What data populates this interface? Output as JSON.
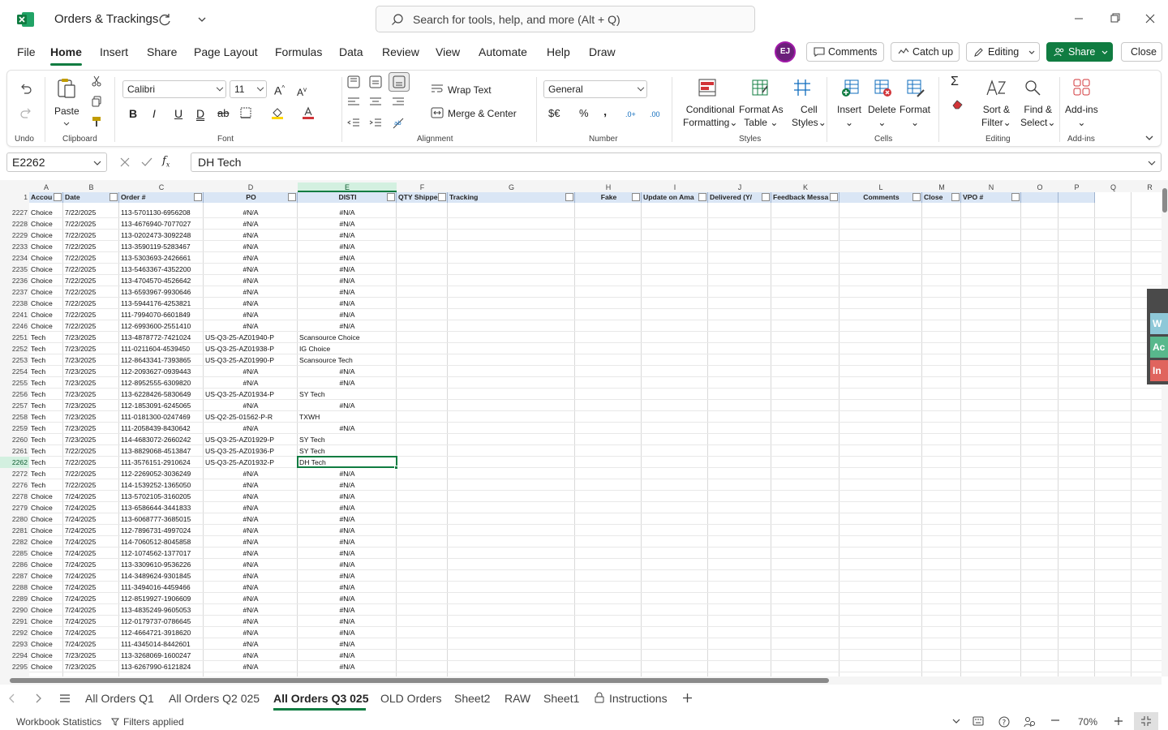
{
  "titlebar": {
    "doc_title": "Orders & Trackings",
    "search_placeholder": "Search for tools, help, and more (Alt + Q)"
  },
  "menu": [
    "File",
    "Home",
    "Insert",
    "Share",
    "Page Layout",
    "Formulas",
    "Data",
    "Review",
    "View",
    "Automate",
    "Help",
    "Draw"
  ],
  "user": {
    "initials": "EJ"
  },
  "top_buttons": {
    "comments": "Comments",
    "catchup": "Catch up",
    "editing": "Editing",
    "share": "Share",
    "close": "Close"
  },
  "ribbon": {
    "undo_group": "Undo",
    "paste": "Paste",
    "clipboard": "Clipboard",
    "font_name": "Calibri",
    "font_size": "11",
    "font_group": "Font",
    "wrap_text": "Wrap Text",
    "merge_center": "Merge & Center",
    "alignment": "Alignment",
    "number_format": "General",
    "number_group": "Number",
    "conditional_1": "Conditional",
    "conditional_2": "Formatting",
    "format_table_1": "Format As",
    "format_table_2": "Table",
    "cell_styles_1": "Cell",
    "cell_styles_2": "Styles",
    "styles_group": "Styles",
    "insert": "Insert",
    "delete": "Delete",
    "format": "Format",
    "cells_group": "Cells",
    "sort_1": "Sort &",
    "sort_2": "Filter",
    "find_1": "Find &",
    "find_2": "Select",
    "editing_group": "Editing",
    "addins": "Add-ins",
    "addins_group": "Add-ins"
  },
  "formula_bar": {
    "name_box": "E2262",
    "formula": "DH Tech"
  },
  "columns": [
    "A",
    "B",
    "C",
    "D",
    "E",
    "F",
    "G",
    "H",
    "I",
    "J",
    "K",
    "L",
    "M",
    "N",
    "O",
    "P",
    "Q",
    "R"
  ],
  "headers": {
    "A": "Accou",
    "B": "Date",
    "C": "Order #",
    "D": "PO",
    "E": "DISTI",
    "F": "QTY Shippe",
    "G": "Tracking",
    "H": "Fake",
    "I": "Update on Ama",
    "J": "Delivered (Y/",
    "K": "Feedback Messa",
    "L": "Comments",
    "M": "Close",
    "N": "VPO #"
  },
  "header_row_num": "1",
  "rows": [
    {
      "n": "2227",
      "a": "Choice",
      "b": "7/22/2025",
      "c": "113-5701130-6956208",
      "d": "#N/A",
      "e": "#N/A"
    },
    {
      "n": "2228",
      "a": "Choice",
      "b": "7/22/2025",
      "c": "113-4676940-7077027",
      "d": "#N/A",
      "e": "#N/A"
    },
    {
      "n": "2229",
      "a": "Choice",
      "b": "7/22/2025",
      "c": "113-0202473-3092248",
      "d": "#N/A",
      "e": "#N/A"
    },
    {
      "n": "2233",
      "a": "Choice",
      "b": "7/22/2025",
      "c": "113-3590119-5283467",
      "d": "#N/A",
      "e": "#N/A"
    },
    {
      "n": "2234",
      "a": "Choice",
      "b": "7/22/2025",
      "c": "113-5303693-2426661",
      "d": "#N/A",
      "e": "#N/A"
    },
    {
      "n": "2235",
      "a": "Choice",
      "b": "7/22/2025",
      "c": "113-5463367-4352200",
      "d": "#N/A",
      "e": "#N/A"
    },
    {
      "n": "2236",
      "a": "Choice",
      "b": "7/22/2025",
      "c": "113-4704570-4526642",
      "d": "#N/A",
      "e": "#N/A"
    },
    {
      "n": "2237",
      "a": "Choice",
      "b": "7/22/2025",
      "c": "113-6593967-9930646",
      "d": "#N/A",
      "e": "#N/A"
    },
    {
      "n": "2238",
      "a": "Choice",
      "b": "7/22/2025",
      "c": "113-5944176-4253821",
      "d": "#N/A",
      "e": "#N/A"
    },
    {
      "n": "2241",
      "a": "Choice",
      "b": "7/22/2025",
      "c": "111-7994070-6601849",
      "d": "#N/A",
      "e": "#N/A"
    },
    {
      "n": "2246",
      "a": "Choice",
      "b": "7/22/2025",
      "c": "112-6993600-2551410",
      "d": "#N/A",
      "e": "#N/A"
    },
    {
      "n": "2251",
      "a": "Tech",
      "b": "7/23/2025",
      "c": "113-4878772-7421024",
      "d": "US-Q3-25-AZ01940-P",
      "e": "Scansource Choice"
    },
    {
      "n": "2252",
      "a": "Tech",
      "b": "7/23/2025",
      "c": "111-0211604-4539450",
      "d": "US-Q3-25-AZ01938-P",
      "e": "IG Choice"
    },
    {
      "n": "2253",
      "a": "Tech",
      "b": "7/23/2025",
      "c": "112-8643341-7393865",
      "d": "US-Q3-25-AZ01990-P",
      "e": "Scansource Tech"
    },
    {
      "n": "2254",
      "a": "Tech",
      "b": "7/23/2025",
      "c": "112-2093627-0939443",
      "d": "#N/A",
      "e": "#N/A"
    },
    {
      "n": "2255",
      "a": "Tech",
      "b": "7/23/2025",
      "c": "112-8952555-6309820",
      "d": "#N/A",
      "e": "#N/A"
    },
    {
      "n": "2256",
      "a": "Tech",
      "b": "7/23/2025",
      "c": "113-6228426-5830649",
      "d": "US-Q3-25-AZ01934-P",
      "e": "SY Tech"
    },
    {
      "n": "2257",
      "a": "Tech",
      "b": "7/23/2025",
      "c": "112-1853091-6245065",
      "d": "#N/A",
      "e": "#N/A"
    },
    {
      "n": "2258",
      "a": "Tech",
      "b": "7/23/2025",
      "c": "111-0181300-0247469",
      "d": "US-Q2-25-01562-P-R",
      "e": "TXWH"
    },
    {
      "n": "2259",
      "a": "Tech",
      "b": "7/23/2025",
      "c": "111-2058439-8430642",
      "d": "#N/A",
      "e": "#N/A"
    },
    {
      "n": "2260",
      "a": "Tech",
      "b": "7/23/2025",
      "c": "114-4683072-2660242",
      "d": "US-Q3-25-AZ01929-P",
      "e": "SY Tech"
    },
    {
      "n": "2261",
      "a": "Tech",
      "b": "7/22/2025",
      "c": "113-8829068-4513847",
      "d": "US-Q3-25-AZ01936-P",
      "e": "SY Tech"
    },
    {
      "n": "2262",
      "a": "Tech",
      "b": "7/22/2025",
      "c": "111-3576151-2910624",
      "d": "US-Q3-25-AZ01932-P",
      "e": "DH Tech"
    },
    {
      "n": "2272",
      "a": "Tech",
      "b": "7/22/2025",
      "c": "112-2269052-3036249",
      "d": "#N/A",
      "e": "#N/A"
    },
    {
      "n": "2276",
      "a": "Tech",
      "b": "7/22/2025",
      "c": "114-1539252-1365050",
      "d": "#N/A",
      "e": "#N/A"
    },
    {
      "n": "2278",
      "a": "Choice",
      "b": "7/24/2025",
      "c": "113-5702105-3160205",
      "d": "#N/A",
      "e": "#N/A"
    },
    {
      "n": "2279",
      "a": "Choice",
      "b": "7/24/2025",
      "c": "113-6586644-3441833",
      "d": "#N/A",
      "e": "#N/A"
    },
    {
      "n": "2280",
      "a": "Choice",
      "b": "7/24/2025",
      "c": "113-6068777-3685015",
      "d": "#N/A",
      "e": "#N/A"
    },
    {
      "n": "2281",
      "a": "Choice",
      "b": "7/24/2025",
      "c": "112-7896731-4997024",
      "d": "#N/A",
      "e": "#N/A"
    },
    {
      "n": "2282",
      "a": "Choice",
      "b": "7/24/2025",
      "c": "114-7060512-8045858",
      "d": "#N/A",
      "e": "#N/A"
    },
    {
      "n": "2285",
      "a": "Choice",
      "b": "7/24/2025",
      "c": "112-1074562-1377017",
      "d": "#N/A",
      "e": "#N/A"
    },
    {
      "n": "2286",
      "a": "Choice",
      "b": "7/24/2025",
      "c": "113-3309610-9536226",
      "d": "#N/A",
      "e": "#N/A"
    },
    {
      "n": "2287",
      "a": "Choice",
      "b": "7/24/2025",
      "c": "114-3489624-9301845",
      "d": "#N/A",
      "e": "#N/A"
    },
    {
      "n": "2288",
      "a": "Choice",
      "b": "7/24/2025",
      "c": "111-3494016-4459466",
      "d": "#N/A",
      "e": "#N/A"
    },
    {
      "n": "2289",
      "a": "Choice",
      "b": "7/24/2025",
      "c": "112-8519927-1906609",
      "d": "#N/A",
      "e": "#N/A"
    },
    {
      "n": "2290",
      "a": "Choice",
      "b": "7/24/2025",
      "c": "113-4835249-9605053",
      "d": "#N/A",
      "e": "#N/A"
    },
    {
      "n": "2291",
      "a": "Choice",
      "b": "7/24/2025",
      "c": "112-0179737-0786645",
      "d": "#N/A",
      "e": "#N/A"
    },
    {
      "n": "2292",
      "a": "Choice",
      "b": "7/24/2025",
      "c": "112-4664721-3918620",
      "d": "#N/A",
      "e": "#N/A"
    },
    {
      "n": "2293",
      "a": "Choice",
      "b": "7/24/2025",
      "c": "111-4345014-8442601",
      "d": "#N/A",
      "e": "#N/A"
    },
    {
      "n": "2294",
      "a": "Choice",
      "b": "7/23/2025",
      "c": "113-3268069-1600247",
      "d": "#N/A",
      "e": "#N/A"
    },
    {
      "n": "2295",
      "a": "Choice",
      "b": "7/23/2025",
      "c": "113-6267990-6121824",
      "d": "#N/A",
      "e": "#N/A"
    }
  ],
  "side_tabs": [
    "W",
    "Ac",
    "In"
  ],
  "sheet_tabs": [
    "All Orders Q1",
    "All Orders Q2 025",
    "All Orders Q3 025",
    "OLD Orders",
    "Sheet2",
    "RAW",
    "Sheet1",
    "Instructions"
  ],
  "status": {
    "stats": "Workbook Statistics",
    "filters": "Filters applied",
    "zoom": "70%"
  },
  "colors": {
    "accent": "#107c41",
    "header_fill": "#dae6f5",
    "avatar": "#6b1f7a"
  }
}
